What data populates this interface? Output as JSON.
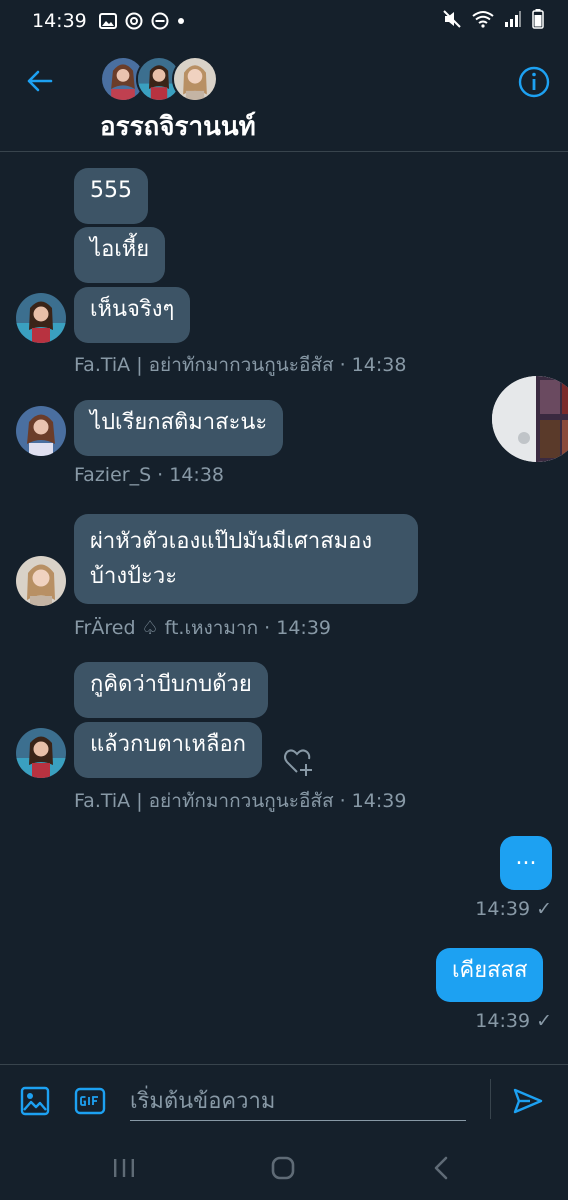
{
  "status": {
    "time": "14:39"
  },
  "header": {
    "title": "อรรถจิรานนท์"
  },
  "messages": [
    {
      "text": "555"
    },
    {
      "text": "ไอเหี้ย"
    },
    {
      "text": "เห็นจริงๆ"
    },
    {
      "meta": "Fa.TiA | อย่าทักมากวนกูนะอีสัส · 14:38"
    },
    {
      "text": "ไปเรียกสติมาสะนะ"
    },
    {
      "meta": "Fazier_S · 14:38"
    },
    {
      "text_line1": "ผ่าหัวตัวเองแป๊ปมันมีเศาสมอง",
      "text_line2": "บ้างป้ะวะ"
    },
    {
      "meta": "FrÄred ♤ ft.เหงามาก · 14:39"
    },
    {
      "text": "กูคิดว่าบีบกบด้วย"
    },
    {
      "text": "แล้วกบตาเหลือก"
    },
    {
      "meta": "Fa.TiA | อย่าทักมากวนกูนะอีสัส · 14:39"
    },
    {
      "text": "..."
    },
    {
      "meta": "14:39 ✓"
    },
    {
      "text": "เคียสสส"
    },
    {
      "meta": "14:39 ✓"
    }
  ],
  "composer": {
    "placeholder": "เริ่มต้นข้อความ"
  },
  "colors": {
    "background": "#15202b",
    "bubble_received": "#3d5466",
    "bubble_sent": "#1da1f2",
    "accent": "#1da1f2",
    "meta_text": "#8899a6"
  }
}
